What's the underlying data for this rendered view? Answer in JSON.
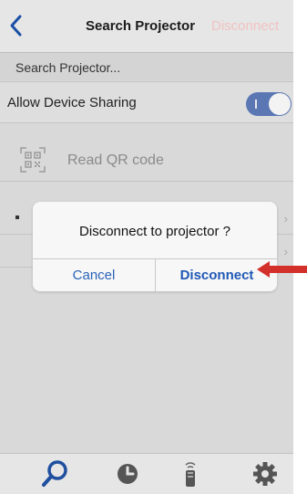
{
  "navbar": {
    "title": "Search Projector",
    "action_label": "Disconnect",
    "back_icon": "chevron-left-icon"
  },
  "section": {
    "header": "Search Projector..."
  },
  "sharing": {
    "label": "Allow Device Sharing",
    "toggle_on": true
  },
  "qr": {
    "label": "Read QR code",
    "icon": "qr-code-icon"
  },
  "alert": {
    "title": "Disconnect to projector ?",
    "cancel_label": "Cancel",
    "confirm_label": "Disconnect"
  },
  "annotation": {
    "arrow_color": "#d3302c"
  },
  "tabbar": {
    "tabs": [
      {
        "icon": "search-icon"
      },
      {
        "icon": "history-icon"
      },
      {
        "icon": "remote-icon"
      },
      {
        "icon": "gear-icon"
      }
    ]
  },
  "colors": {
    "accent": "#2c63b8",
    "toggle": "#5a77b3",
    "action_disabled": "#f1c2c2"
  }
}
